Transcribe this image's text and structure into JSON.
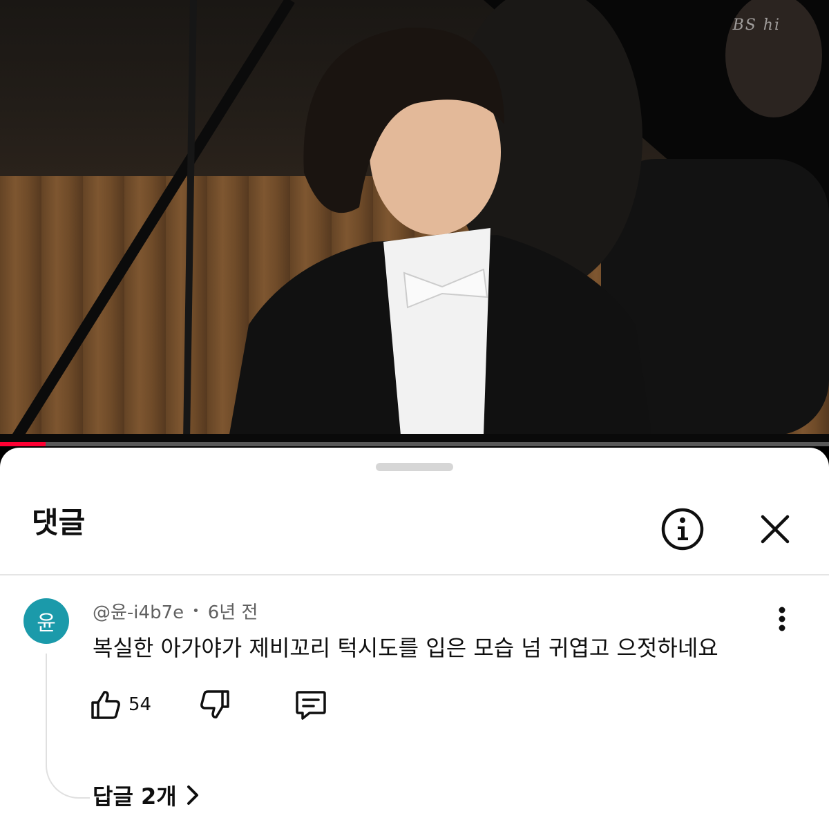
{
  "video": {
    "watermark": "BS hi",
    "progress_fraction": 0.055,
    "progress_color": "#ff0033"
  },
  "panel": {
    "title": "댓글",
    "info_icon": "info-circle-icon",
    "close_icon": "close-icon"
  },
  "comment": {
    "avatar_letter": "윤",
    "avatar_color": "#1b9aaa",
    "author": "@윤-i4b7e",
    "separator": "•",
    "time": "6년 전",
    "text": "복실한 아가야가 제비꼬리 턱시도를 입은 모습 넘 귀엽고 으젓하네요",
    "likes": "54",
    "more_icon": "more-vertical-icon",
    "like_icon": "thumbs-up-icon",
    "dislike_icon": "thumbs-down-icon",
    "reply_icon": "comment-icon",
    "replies_label": "답글 2개",
    "replies_chevron": "chevron-right-icon"
  }
}
